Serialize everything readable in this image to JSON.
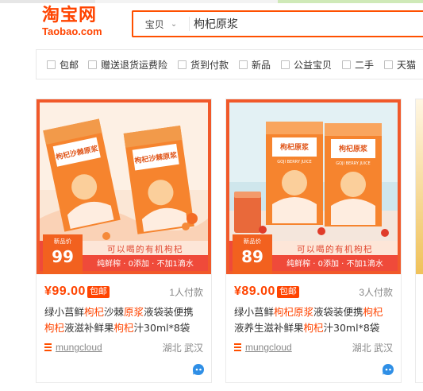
{
  "header": {
    "logo_cn": "淘宝网",
    "logo_en": "Taobao.com",
    "search_scope": "宝贝",
    "search_value": "枸杞原浆"
  },
  "filters": [
    "包邮",
    "赠送退货运费险",
    "货到付款",
    "新品",
    "公益宝贝",
    "二手",
    "天猫"
  ],
  "products": [
    {
      "price": "¥99.00",
      "badge": "包邮",
      "sales": "1人付款",
      "title_segments": [
        {
          "text": "绿小莒鲜",
          "hl": false
        },
        {
          "text": "枸杞",
          "hl": true
        },
        {
          "text": "沙棘",
          "hl": false
        },
        {
          "text": "原浆",
          "hl": true
        },
        {
          "text": "液袋装便携",
          "hl": false
        },
        {
          "text": "枸杞",
          "hl": true
        },
        {
          "text": "液滋补鲜果",
          "hl": false
        },
        {
          "text": "枸杞",
          "hl": true
        },
        {
          "text": "汁30ml*8袋",
          "hl": false
        }
      ],
      "shop": "mungcloud",
      "location": "湖北 武汉",
      "image": {
        "box_label": "枸杞沙棘原浆",
        "ribbon_top": "新品价",
        "ribbon_price": "99",
        "banner_line1": "可以喝的有机枸杞",
        "banner_line2": "纯鲜榨 · 0添加 · 不加1滴水"
      }
    },
    {
      "price": "¥89.00",
      "badge": "包邮",
      "sales": "3人付款",
      "title_segments": [
        {
          "text": "绿小莒鲜",
          "hl": false
        },
        {
          "text": "枸杞原浆",
          "hl": true
        },
        {
          "text": "液袋装便携",
          "hl": false
        },
        {
          "text": "枸杞",
          "hl": true
        },
        {
          "text": "液养生滋补鲜果",
          "hl": false
        },
        {
          "text": "枸杞",
          "hl": true
        },
        {
          "text": "汁30ml*8袋",
          "hl": false
        }
      ],
      "shop": "mungcloud",
      "location": "湖北 武汉",
      "image": {
        "box_label": "枸杞原浆",
        "box_sub": "GOJI BERRY JUICE",
        "ribbon_top": "新品价",
        "ribbon_price": "89",
        "banner_line1": "可以喝的有机枸杞",
        "banner_line2": "纯鲜榨 · 0添加 · 不加1滴水"
      }
    }
  ],
  "colors": {
    "accent": "#ff4400",
    "search_border": "#ff5000",
    "banner": "#ef4a3a",
    "ribbon": "#f2611f",
    "box": "#f6842e"
  }
}
